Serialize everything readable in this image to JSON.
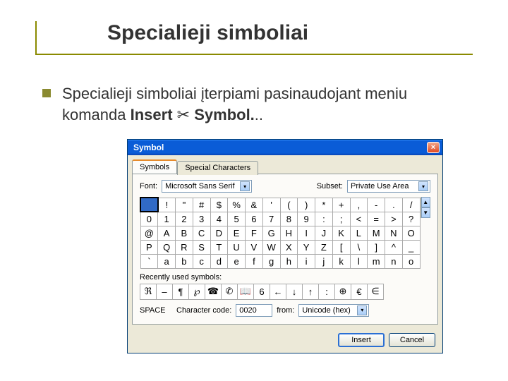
{
  "slide": {
    "title": "Specialieji simboliai",
    "bullet_prefix": "Specialieji simboliai įterpiami pasinaudojant meniu komanda ",
    "bullet_bold1": "Insert",
    "bullet_arrow": " ✂ ",
    "bullet_bold2": "Symbol.",
    "bullet_tail": ".."
  },
  "dialog": {
    "title": "Symbol",
    "close": "×",
    "tabs": {
      "symbols": "Symbols",
      "special": "Special Characters"
    },
    "labels": {
      "font": "Font:",
      "subset": "Subset:",
      "recently": "Recently used symbols:",
      "charname": "SPACE",
      "charcode": "Character code:",
      "from": "from:"
    },
    "font_value": "Microsoft Sans Serif",
    "subset_value": "Private Use Area",
    "charcode_value": "0020",
    "from_value": "Unicode (hex)",
    "grid": [
      [
        " ",
        "!",
        "\"",
        "#",
        "$",
        "%",
        "&",
        "'",
        "(",
        ")",
        "*",
        "+",
        ",",
        "-",
        ".",
        "/"
      ],
      [
        "0",
        "1",
        "2",
        "3",
        "4",
        "5",
        "6",
        "7",
        "8",
        "9",
        ":",
        ";",
        "<",
        "=",
        ">",
        "?"
      ],
      [
        "@",
        "A",
        "B",
        "C",
        "D",
        "E",
        "F",
        "G",
        "H",
        "I",
        "J",
        "K",
        "L",
        "M",
        "N",
        "O"
      ],
      [
        "P",
        "Q",
        "R",
        "S",
        "T",
        "U",
        "V",
        "W",
        "X",
        "Y",
        "Z",
        "[",
        "\\",
        "]",
        "^",
        "_"
      ],
      [
        "`",
        "a",
        "b",
        "c",
        "d",
        "e",
        "f",
        "g",
        "h",
        "i",
        "j",
        "k",
        "l",
        "m",
        "n",
        "o"
      ]
    ],
    "selected": [
      0,
      0
    ],
    "recent": [
      "ℜ",
      "–",
      "¶",
      "℘",
      "☎",
      "✆",
      "📖",
      "6",
      "←",
      "↓",
      "↑",
      ":",
      "⊕",
      "€",
      "∈"
    ],
    "buttons": {
      "insert": "Insert",
      "cancel": "Cancel"
    },
    "scroll": {
      "up": "▲",
      "down": "▼"
    }
  }
}
